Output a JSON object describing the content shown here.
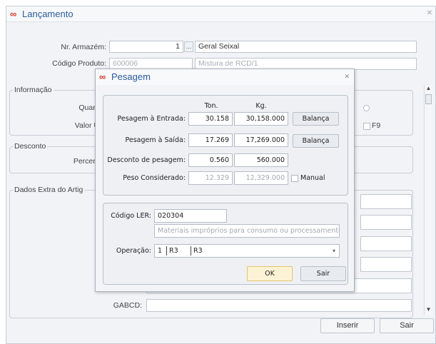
{
  "window": {
    "title": "Lançamento",
    "fields": {
      "nr_armazem_label": "Nr. Armazém:",
      "nr_armazem_value": "1",
      "nr_armazem_btn": "...",
      "armazem_name": "Geral Seixal",
      "codigo_produto_label": "Código Produto:",
      "codigo_produto_value": "600006",
      "produto_name": "Mistura de RCD/1"
    },
    "groups": {
      "informacao": "Informação",
      "quant_label": "Quant",
      "valor_label": "Valor U",
      "f9_label": "F9",
      "desconto": "Desconto",
      "percent_label": "Percent",
      "dados_extra": "Dados Extra do Artig",
      "gabcd_label": "GABCD:"
    },
    "buttons": {
      "inserir": "Inserir",
      "sair": "Sair"
    }
  },
  "dialog": {
    "title": "Pesagem",
    "headers": {
      "ton": "Ton.",
      "kg": "Kg."
    },
    "rows": {
      "entrada_label": "Pesagem à Entrada:",
      "entrada_ton": "30.158",
      "entrada_kg": "30,158.000",
      "saida_label": "Pesagem à Saída:",
      "saida_ton": "17.269",
      "saida_kg": "17,269.000",
      "desconto_label": "Desconto de pesagem:",
      "desconto_ton": "0.560",
      "desconto_kg": "560.000",
      "peso_label": "Peso Considerado:",
      "peso_ton": "12.329",
      "peso_kg": "12,329.000",
      "manual_label": "Manual"
    },
    "balanca_label": "Balança",
    "ler": {
      "label": "Código LER:",
      "value": "020304",
      "description": "Materiais impróprios para consumo ou processamento"
    },
    "operacao": {
      "label": "Operação:",
      "col1": "1",
      "col2": "R3",
      "col3": "R3"
    },
    "buttons": {
      "ok": "OK",
      "sair": "Sair"
    }
  }
}
